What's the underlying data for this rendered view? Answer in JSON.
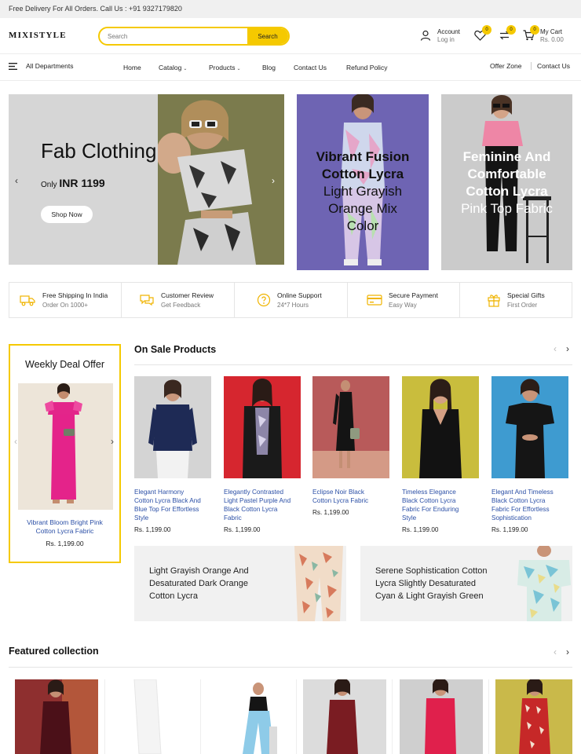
{
  "topbar": {
    "announcement": "Free Delivery For All Orders. Call Us : +91 9327179820"
  },
  "header": {
    "logo": "MIXISTYLE",
    "search": {
      "placeholder": "Search",
      "button_label": "Search"
    },
    "account": {
      "title": "Account",
      "subtitle": "Log in"
    },
    "wishlist_count": "0",
    "compare_count": "0",
    "cart": {
      "count": "0",
      "title": "My Cart",
      "amount": "Rs. 0.00"
    }
  },
  "nav": {
    "departments": "All Departments",
    "items": [
      {
        "label": "Home"
      },
      {
        "label": "Catalog"
      },
      {
        "label": "Products"
      },
      {
        "label": "Blog"
      },
      {
        "label": "Contact Us"
      },
      {
        "label": "Refund Policy"
      }
    ],
    "right": [
      {
        "label": "Offer Zone"
      },
      {
        "label": "Contact Us"
      }
    ]
  },
  "hero": {
    "main": {
      "title": "Fab Clothing",
      "price_prefix": "Only",
      "price": "INR 1199",
      "button": "Shop Now"
    },
    "banner1": {
      "bold_line1": "Vibrant Fusion",
      "bold_line2": "Cotton Lycra",
      "line3": "Light Grayish",
      "line4": "Orange Mix",
      "line5": "Color"
    },
    "banner2": {
      "bold_line1": "Feminine And",
      "bold_line2": "Comfortable",
      "bold_line3": "Cotton Lycra",
      "line4": "Pink Top Fabric"
    }
  },
  "features": [
    {
      "title": "Free Shipping In India",
      "subtitle": "Order On 1000+",
      "icon": "truck-icon"
    },
    {
      "title": "Customer Review",
      "subtitle": "Get Feedback",
      "icon": "chat-icon"
    },
    {
      "title": "Online Support",
      "subtitle": "24*7 Hours",
      "icon": "help-icon"
    },
    {
      "title": "Secure Payment",
      "subtitle": "Easy Way",
      "icon": "card-icon"
    },
    {
      "title": "Special Gifts",
      "subtitle": "First Order",
      "icon": "gift-icon"
    }
  ],
  "weekly_deal": {
    "title": "Weekly Deal Offer",
    "product": {
      "name_line1": "Vibrant Bloom Bright Pink",
      "name_line2": "Cotton Lycra Fabric",
      "price": "Rs. 1,199.00"
    }
  },
  "on_sale": {
    "title": "On Sale Products",
    "products": [
      {
        "lines": [
          "Elegant Harmony",
          "Cotton Lycra Black And",
          "Blue Top For Effortless",
          "Style"
        ],
        "price": "Rs. 1,199.00"
      },
      {
        "lines": [
          "Elegantly Contrasted",
          "Light Pastel Purple And",
          "Black Cotton Lycra",
          "Fabric"
        ],
        "price": "Rs. 1,199.00"
      },
      {
        "lines": [
          "Eclipse Noir Black",
          "Cotton Lycra Fabric"
        ],
        "price": "Rs. 1,199.00"
      },
      {
        "lines": [
          "Timeless Elegance",
          "Black Cotton Lycra",
          "Fabric For Enduring",
          "Style"
        ],
        "price": "Rs. 1,199.00"
      },
      {
        "lines": [
          "Elegant And Timeless",
          "Black Cotton Lycra",
          "Fabric For Effortless",
          "Sophistication"
        ],
        "price": "Rs. 1,199.00"
      }
    ]
  },
  "promos": [
    {
      "lines": [
        "Light Grayish Orange And",
        "Desaturated Dark Orange",
        "Cotton Lycra"
      ]
    },
    {
      "lines": [
        "Serene Sophistication Cotton",
        "Lycra Slightly Desaturated",
        "Cyan & Light Grayish Green"
      ]
    }
  ],
  "featured": {
    "title": "Featured collection"
  },
  "colors": {
    "accent": "#f5c900",
    "link": "#2b4fa6",
    "banner1_bg": "#6a5fae",
    "banner2_bg": "#c9c9c9"
  }
}
